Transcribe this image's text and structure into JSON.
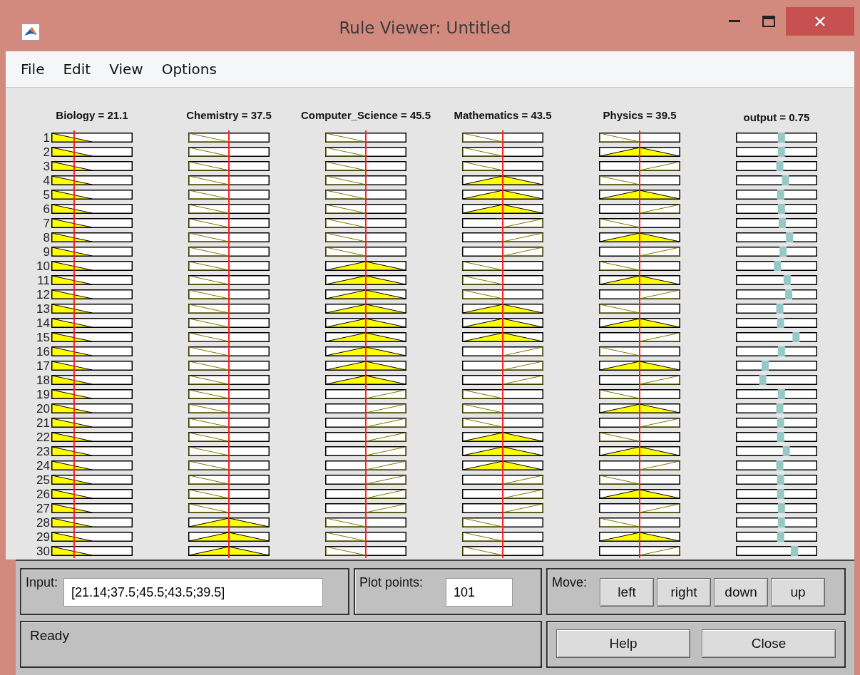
{
  "window": {
    "title": "Rule Viewer: Untitled"
  },
  "menu": [
    "File",
    "Edit",
    "View",
    "Options"
  ],
  "variables": [
    {
      "label": "Biology = 21.1",
      "level": 0.28
    },
    {
      "label": "Chemistry = 37.5",
      "level": 0.5
    },
    {
      "label": "Computer_Science = 45.5",
      "level": 0.5
    },
    {
      "label": "Mathematics = 43.5",
      "level": 0.5
    },
    {
      "label": "Physics = 39.5",
      "level": 0.5
    }
  ],
  "output_variable": {
    "label": "output = 0.75"
  },
  "rules": [
    {
      "number": "1",
      "inputs": [
        {
          "kind": "low",
          "filled": true
        },
        {
          "kind": "low",
          "filled": false
        },
        {
          "kind": "low",
          "filled": false
        },
        {
          "kind": "low",
          "filled": false
        },
        {
          "kind": "low",
          "filled": false
        }
      ],
      "output": {
        "level": 0.56
      }
    },
    {
      "number": "2",
      "inputs": [
        {
          "kind": "low",
          "filled": true
        },
        {
          "kind": "low",
          "filled": false
        },
        {
          "kind": "low",
          "filled": false
        },
        {
          "kind": "low",
          "filled": false
        },
        {
          "kind": "mid",
          "filled": true
        }
      ],
      "output": {
        "level": 0.56
      }
    },
    {
      "number": "3",
      "inputs": [
        {
          "kind": "low",
          "filled": true
        },
        {
          "kind": "low",
          "filled": false
        },
        {
          "kind": "low",
          "filled": false
        },
        {
          "kind": "low",
          "filled": false
        },
        {
          "kind": "high",
          "filled": false
        }
      ],
      "output": {
        "level": 0.54
      }
    },
    {
      "number": "4",
      "inputs": [
        {
          "kind": "low",
          "filled": true
        },
        {
          "kind": "low",
          "filled": false
        },
        {
          "kind": "low",
          "filled": false
        },
        {
          "kind": "mid",
          "filled": true
        },
        {
          "kind": "low",
          "filled": false
        }
      ],
      "output": {
        "level": 0.61
      }
    },
    {
      "number": "5",
      "inputs": [
        {
          "kind": "low",
          "filled": true
        },
        {
          "kind": "low",
          "filled": false
        },
        {
          "kind": "low",
          "filled": false
        },
        {
          "kind": "mid",
          "filled": true
        },
        {
          "kind": "mid",
          "filled": true
        }
      ],
      "output": {
        "level": 0.55
      }
    },
    {
      "number": "6",
      "inputs": [
        {
          "kind": "low",
          "filled": true
        },
        {
          "kind": "low",
          "filled": false
        },
        {
          "kind": "low",
          "filled": false
        },
        {
          "kind": "mid",
          "filled": true
        },
        {
          "kind": "high",
          "filled": false
        }
      ],
      "output": {
        "level": 0.56
      }
    },
    {
      "number": "7",
      "inputs": [
        {
          "kind": "low",
          "filled": true
        },
        {
          "kind": "low",
          "filled": false
        },
        {
          "kind": "low",
          "filled": false
        },
        {
          "kind": "high",
          "filled": false
        },
        {
          "kind": "low",
          "filled": false
        }
      ],
      "output": {
        "level": 0.57
      }
    },
    {
      "number": "8",
      "inputs": [
        {
          "kind": "low",
          "filled": true
        },
        {
          "kind": "low",
          "filled": false
        },
        {
          "kind": "low",
          "filled": false
        },
        {
          "kind": "high",
          "filled": false
        },
        {
          "kind": "mid",
          "filled": true
        }
      ],
      "output": {
        "level": 0.66
      }
    },
    {
      "number": "9",
      "inputs": [
        {
          "kind": "low",
          "filled": true
        },
        {
          "kind": "low",
          "filled": false
        },
        {
          "kind": "low",
          "filled": false
        },
        {
          "kind": "high",
          "filled": false
        },
        {
          "kind": "high",
          "filled": false
        }
      ],
      "output": {
        "level": 0.58
      }
    },
    {
      "number": "10",
      "inputs": [
        {
          "kind": "low",
          "filled": true
        },
        {
          "kind": "low",
          "filled": false
        },
        {
          "kind": "mid",
          "filled": true
        },
        {
          "kind": "low",
          "filled": false
        },
        {
          "kind": "low",
          "filled": false
        }
      ],
      "output": {
        "level": 0.51
      }
    },
    {
      "number": "11",
      "inputs": [
        {
          "kind": "low",
          "filled": true
        },
        {
          "kind": "low",
          "filled": false
        },
        {
          "kind": "mid",
          "filled": true
        },
        {
          "kind": "low",
          "filled": false
        },
        {
          "kind": "mid",
          "filled": true
        }
      ],
      "output": {
        "level": 0.63
      }
    },
    {
      "number": "12",
      "inputs": [
        {
          "kind": "low",
          "filled": true
        },
        {
          "kind": "low",
          "filled": false
        },
        {
          "kind": "mid",
          "filled": true
        },
        {
          "kind": "low",
          "filled": false
        },
        {
          "kind": "high",
          "filled": false
        }
      ],
      "output": {
        "level": 0.65
      }
    },
    {
      "number": "13",
      "inputs": [
        {
          "kind": "low",
          "filled": true
        },
        {
          "kind": "low",
          "filled": false
        },
        {
          "kind": "mid",
          "filled": true
        },
        {
          "kind": "mid",
          "filled": true
        },
        {
          "kind": "low",
          "filled": false
        }
      ],
      "output": {
        "level": 0.54
      }
    },
    {
      "number": "14",
      "inputs": [
        {
          "kind": "low",
          "filled": true
        },
        {
          "kind": "low",
          "filled": false
        },
        {
          "kind": "mid",
          "filled": true
        },
        {
          "kind": "mid",
          "filled": true
        },
        {
          "kind": "mid",
          "filled": true
        }
      ],
      "output": {
        "level": 0.55
      }
    },
    {
      "number": "15",
      "inputs": [
        {
          "kind": "low",
          "filled": true
        },
        {
          "kind": "low",
          "filled": false
        },
        {
          "kind": "mid",
          "filled": true
        },
        {
          "kind": "mid",
          "filled": true
        },
        {
          "kind": "high",
          "filled": false
        }
      ],
      "output": {
        "level": 0.74
      }
    },
    {
      "number": "16",
      "inputs": [
        {
          "kind": "low",
          "filled": true
        },
        {
          "kind": "low",
          "filled": false
        },
        {
          "kind": "mid",
          "filled": true
        },
        {
          "kind": "high",
          "filled": false
        },
        {
          "kind": "low",
          "filled": false
        }
      ],
      "output": {
        "level": 0.56
      }
    },
    {
      "number": "17",
      "inputs": [
        {
          "kind": "low",
          "filled": true
        },
        {
          "kind": "low",
          "filled": false
        },
        {
          "kind": "mid",
          "filled": true
        },
        {
          "kind": "high",
          "filled": false
        },
        {
          "kind": "mid",
          "filled": true
        }
      ],
      "output": {
        "level": 0.36
      }
    },
    {
      "number": "18",
      "inputs": [
        {
          "kind": "low",
          "filled": true
        },
        {
          "kind": "low",
          "filled": false
        },
        {
          "kind": "mid",
          "filled": true
        },
        {
          "kind": "high",
          "filled": false
        },
        {
          "kind": "high",
          "filled": false
        }
      ],
      "output": {
        "level": 0.33
      }
    },
    {
      "number": "19",
      "inputs": [
        {
          "kind": "low",
          "filled": true
        },
        {
          "kind": "low",
          "filled": false
        },
        {
          "kind": "high",
          "filled": false
        },
        {
          "kind": "low",
          "filled": false
        },
        {
          "kind": "low",
          "filled": false
        }
      ],
      "output": {
        "level": 0.56
      }
    },
    {
      "number": "20",
      "inputs": [
        {
          "kind": "low",
          "filled": true
        },
        {
          "kind": "low",
          "filled": false
        },
        {
          "kind": "high",
          "filled": false
        },
        {
          "kind": "low",
          "filled": false
        },
        {
          "kind": "mid",
          "filled": true
        }
      ],
      "output": {
        "level": 0.54
      }
    },
    {
      "number": "21",
      "inputs": [
        {
          "kind": "low",
          "filled": true
        },
        {
          "kind": "low",
          "filled": false
        },
        {
          "kind": "high",
          "filled": false
        },
        {
          "kind": "low",
          "filled": false
        },
        {
          "kind": "high",
          "filled": false
        }
      ],
      "output": {
        "level": 0.55
      }
    },
    {
      "number": "22",
      "inputs": [
        {
          "kind": "low",
          "filled": true
        },
        {
          "kind": "low",
          "filled": false
        },
        {
          "kind": "high",
          "filled": false
        },
        {
          "kind": "mid",
          "filled": true
        },
        {
          "kind": "low",
          "filled": false
        }
      ],
      "output": {
        "level": 0.55
      }
    },
    {
      "number": "23",
      "inputs": [
        {
          "kind": "low",
          "filled": true
        },
        {
          "kind": "low",
          "filled": false
        },
        {
          "kind": "high",
          "filled": false
        },
        {
          "kind": "mid",
          "filled": true
        },
        {
          "kind": "mid",
          "filled": true
        }
      ],
      "output": {
        "level": 0.62
      }
    },
    {
      "number": "24",
      "inputs": [
        {
          "kind": "low",
          "filled": true
        },
        {
          "kind": "low",
          "filled": false
        },
        {
          "kind": "high",
          "filled": false
        },
        {
          "kind": "mid",
          "filled": true
        },
        {
          "kind": "high",
          "filled": false
        }
      ],
      "output": {
        "level": 0.54
      }
    },
    {
      "number": "25",
      "inputs": [
        {
          "kind": "low",
          "filled": true
        },
        {
          "kind": "low",
          "filled": false
        },
        {
          "kind": "high",
          "filled": false
        },
        {
          "kind": "high",
          "filled": false
        },
        {
          "kind": "low",
          "filled": false
        }
      ],
      "output": {
        "level": 0.55
      }
    },
    {
      "number": "26",
      "inputs": [
        {
          "kind": "low",
          "filled": true
        },
        {
          "kind": "low",
          "filled": false
        },
        {
          "kind": "high",
          "filled": false
        },
        {
          "kind": "high",
          "filled": false
        },
        {
          "kind": "mid",
          "filled": true
        }
      ],
      "output": {
        "level": 0.55
      }
    },
    {
      "number": "27",
      "inputs": [
        {
          "kind": "low",
          "filled": true
        },
        {
          "kind": "low",
          "filled": false
        },
        {
          "kind": "high",
          "filled": false
        },
        {
          "kind": "high",
          "filled": false
        },
        {
          "kind": "high",
          "filled": false
        }
      ],
      "output": {
        "level": 0.56
      }
    },
    {
      "number": "28",
      "inputs": [
        {
          "kind": "low",
          "filled": true
        },
        {
          "kind": "mid",
          "filled": true
        },
        {
          "kind": "low",
          "filled": false
        },
        {
          "kind": "low",
          "filled": false
        },
        {
          "kind": "low",
          "filled": false
        }
      ],
      "output": {
        "level": 0.56
      }
    },
    {
      "number": "29",
      "inputs": [
        {
          "kind": "low",
          "filled": true
        },
        {
          "kind": "mid",
          "filled": true
        },
        {
          "kind": "low",
          "filled": false
        },
        {
          "kind": "low",
          "filled": false
        },
        {
          "kind": "mid",
          "filled": true
        }
      ],
      "output": {
        "level": 0.55
      }
    },
    {
      "number": "30",
      "inputs": [
        {
          "kind": "low",
          "filled": true
        },
        {
          "kind": "mid",
          "filled": true
        },
        {
          "kind": "low",
          "filled": false
        },
        {
          "kind": "low",
          "filled": false
        },
        {
          "kind": "high",
          "filled": false
        }
      ],
      "output": {
        "level": 0.72
      }
    }
  ],
  "input": {
    "label": "Input:",
    "value": "[21.14;37.5;45.5;43.5;39.5]"
  },
  "plot_points": {
    "label": "Plot points:",
    "value": "101"
  },
  "move": {
    "label": "Move:",
    "buttons": [
      "left",
      "right",
      "down",
      "up"
    ]
  },
  "status": "Ready",
  "buttons": [
    "Help",
    "Close"
  ]
}
